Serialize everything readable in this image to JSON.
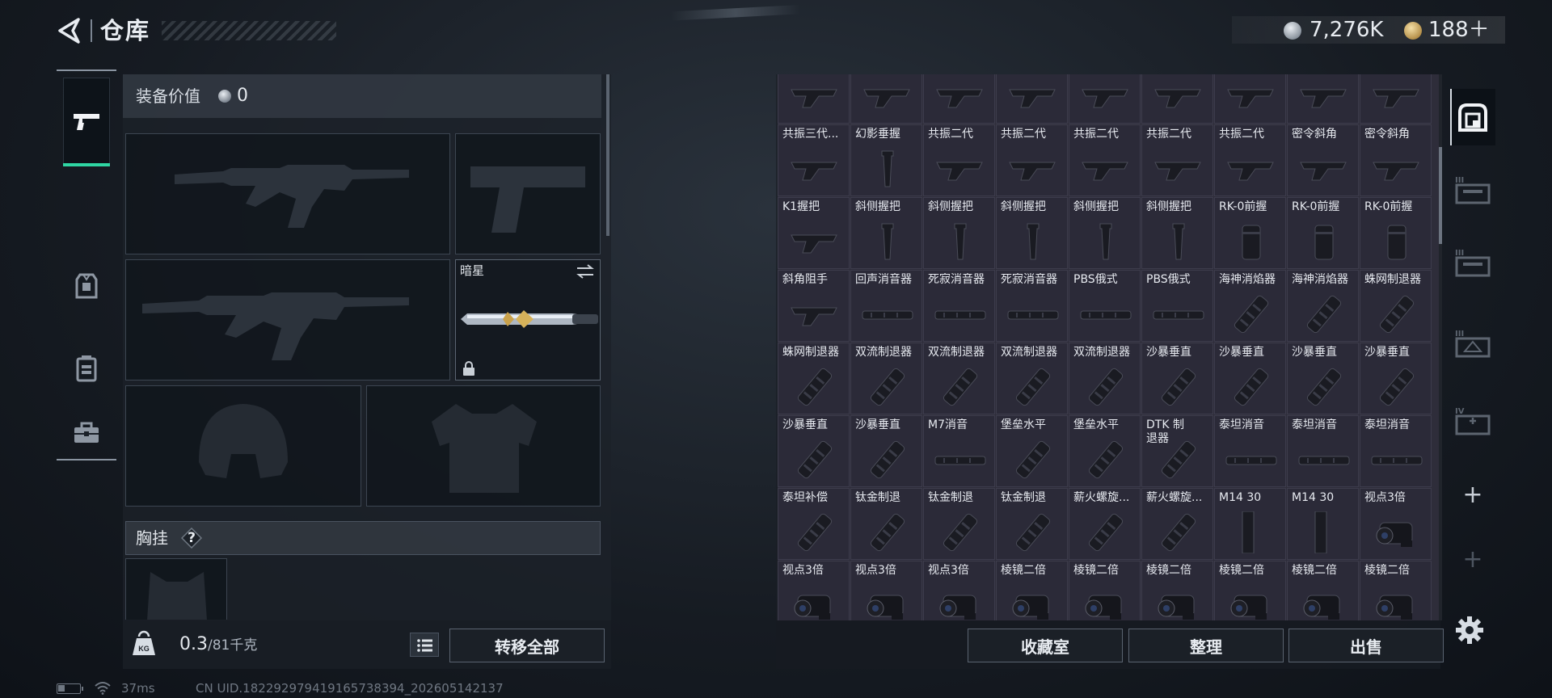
{
  "header": {
    "title": "仓库",
    "currency": {
      "silver": "7,276K",
      "gold": "188＋"
    }
  },
  "equipment": {
    "value_label": "装备价值",
    "value": "0",
    "slots": {
      "melee_name": "暗星"
    },
    "rig_label": "胸挂",
    "rig_help": "?",
    "weight_value": "0.3",
    "weight_capacity": "/81千克",
    "transfer_label": "转移全部"
  },
  "storage": {
    "items": [
      [
        "",
        "",
        "",
        "",
        "",
        "",
        "",
        "",
        ""
      ],
      [
        "共振三代...",
        "幻影垂握",
        "共振二代",
        "共振二代",
        "共振二代",
        "共振二代",
        "共振二代",
        "密令斜角",
        "密令斜角"
      ],
      [
        "K1握把",
        "斜侧握把",
        "斜侧握把",
        "斜侧握把",
        "斜侧握把",
        "斜侧握把",
        "RK-0前握",
        "RK-0前握",
        "RK-0前握"
      ],
      [
        "斜角阻手",
        "回声消音器",
        "死寂消音器",
        "死寂消音器",
        "PBS俄式",
        "PBS俄式",
        "海神消焰器",
        "海神消焰器",
        "蛛网制退器"
      ],
      [
        "蛛网制退器",
        "双流制退器",
        "双流制退器",
        "双流制退器",
        "双流制退器",
        "沙暴垂直",
        "沙暴垂直",
        "沙暴垂直",
        "沙暴垂直"
      ],
      [
        "沙暴垂直",
        "沙暴垂直",
        "M7消音",
        "堡垒水平",
        "堡垒水平",
        "DTK 制退器",
        "泰坦消音",
        "泰坦消音",
        "泰坦消音"
      ],
      [
        "泰坦补偿",
        "钛金制退",
        "钛金制退",
        "钛金制退",
        "薪火螺旋...",
        "薪火螺旋...",
        "M14 30",
        "M14 30",
        "视点3倍"
      ],
      [
        "视点3倍",
        "视点3倍",
        "视点3倍",
        "棱镜二倍",
        "棱镜二倍",
        "棱镜二倍",
        "棱镜二倍",
        "棱镜二倍",
        "棱镜二倍"
      ]
    ],
    "buttons": {
      "collection": "收藏室",
      "sort": "整理",
      "sell": "出售"
    }
  },
  "right_rail": {
    "crate_labels": [
      "III",
      "III",
      "III",
      "IV"
    ]
  },
  "status": {
    "ping": "37ms",
    "uid": "CN UID.18229297941916573839​4_202605142137",
    "battery_level": 0.3
  },
  "colors": {
    "accent_active": "#2fd6a3",
    "cell_bg": "#2b2a38"
  }
}
